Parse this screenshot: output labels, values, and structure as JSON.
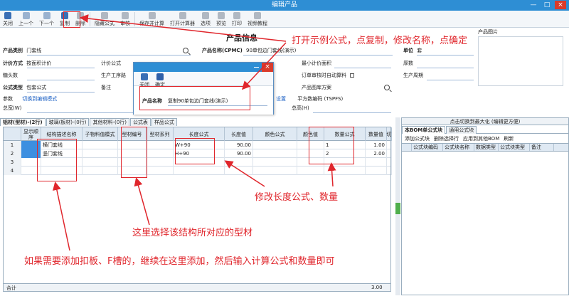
{
  "window": {
    "title": "编辑产品",
    "min": "—",
    "max": "□",
    "close": "×"
  },
  "toolbar": [
    {
      "label": "关闭",
      "icon": "close-icon",
      "color": "#3a6fb5"
    },
    {
      "label": "上一个",
      "icon": "prev-icon",
      "color": "#9ab2cf"
    },
    {
      "label": "下一个",
      "icon": "next-icon",
      "color": "#9ab2cf"
    },
    {
      "label": "复制",
      "icon": "copy-icon",
      "color": "#3a6fb5"
    },
    {
      "label": "删除",
      "icon": "delete-icon",
      "color": "#b0b8c2"
    },
    {
      "label": "隐藏公式",
      "icon": "hide-formula-icon",
      "color": "#b0b8c2"
    },
    {
      "label": "审核",
      "icon": "audit-icon",
      "color": "#b0b8c2"
    },
    {
      "label": "保存并计算",
      "icon": "save-calc-icon",
      "color": "#b0b8c2"
    },
    {
      "label": "打开计算器",
      "icon": "calculator-icon",
      "color": "#b0b8c2"
    },
    {
      "label": "选项",
      "icon": "options-icon",
      "color": "#b0b8c2"
    },
    {
      "label": "预览",
      "icon": "preview-icon",
      "color": "#b0b8c2"
    },
    {
      "label": "打印",
      "icon": "print-icon",
      "color": "#b0b8c2"
    },
    {
      "label": "视频教程",
      "icon": "video-icon",
      "color": "#b0b8c2"
    }
  ],
  "form": {
    "header": "产品信息",
    "product_category_label": "产品类别",
    "product_category": "门套线",
    "pricing_label": "计价方式",
    "pricing": "按面积计价",
    "pricing_formula_label": "计价公式",
    "sugar_label": "糖头数",
    "process_label": "生产工序路",
    "formula_type_label": "公式类型",
    "formula_type": "包套公式",
    "remark_label": "备注",
    "param_label": "参数",
    "param_link": "切换到编辑模式",
    "total_length_label": "总宽(W)",
    "product_name_label": "产品名称(CPMC)",
    "product_name": "90单包边门套线(演示)",
    "min_area_label": "最小计价面积",
    "order_audit_label": "订单审核时自动算料",
    "drawing_label": "产品图库方案",
    "unit_label": "单位",
    "unit": "套",
    "thickness_label": "厚数",
    "cycle_label": "生产周期",
    "settings_link": "设置",
    "sqm_label": "平方数编码 (TSPFS)",
    "total_height_label": "总高(H)",
    "image_label": "产品图片"
  },
  "tabs": [
    "铝材(型材)-(2行)",
    "玻璃(板材)-(0行)",
    "其他材料-(0行)",
    "公式表",
    "样品公式"
  ],
  "grid": {
    "headers": [
      "显示顺序",
      "结构描述名称",
      "子物料值模式",
      "型材编号",
      "型材系列",
      "长度公式",
      "长度值",
      "颜色公式",
      "颜色值",
      "数量公式",
      "数量值",
      "切"
    ],
    "rows": [
      {
        "no": "1",
        "name": "横门套线",
        "length_formula": "W+90",
        "length": "90.00",
        "qty_formula": "1",
        "qty": "1.00"
      },
      {
        "no": "2",
        "name": "竖门套线",
        "length_formula": "H+90",
        "length": "90.00",
        "qty_formula": "2",
        "qty": "2.00"
      },
      {
        "no": "3",
        "name": "",
        "length_formula": "",
        "length": "",
        "qty_formula": "",
        "qty": ""
      },
      {
        "no": "4",
        "name": "",
        "length_formula": "",
        "length": "",
        "qty_formula": "",
        "qty": ""
      }
    ],
    "footer_label": "合计",
    "footer_total": "3.00"
  },
  "right_panel": {
    "header": "点击切换到最大化 (编辑更方便)",
    "tabs": [
      "本BOM单公式块",
      "通用公式块"
    ],
    "actions": [
      "添加公式块",
      "删除选择行",
      "应用到其他BOM",
      "刷新"
    ],
    "headers": [
      "公式块编码",
      "公式块名称",
      "数据类型",
      "公式块类型",
      "备注"
    ]
  },
  "dialog": {
    "close_label": "关闭",
    "confirm_label": "确定",
    "name_label": "产品名称",
    "name_value": "复制90单包边门套线(演示)"
  },
  "annotations": {
    "copy": "打开示例公式，点复制，修改名称，点确定",
    "length": "修改长度公式、数量",
    "profile": "这里选择该结构所对应的型材",
    "add": "如果需要添加扣板、F槽的，继续在这里添加，然后输入计算公式和数量即可"
  }
}
